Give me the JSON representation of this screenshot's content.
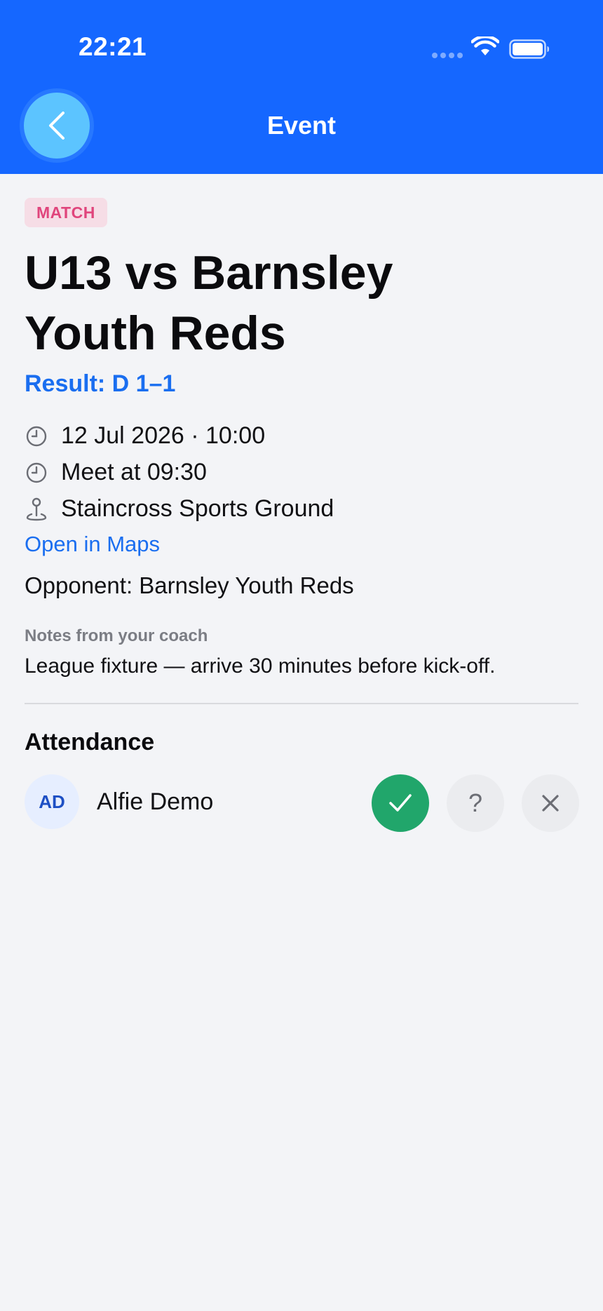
{
  "status_bar": {
    "time": "22:21"
  },
  "header": {
    "title": "Event"
  },
  "event": {
    "type_badge": "MATCH",
    "title": "U13 vs Barnsley Youth Reds",
    "result": "Result: D 1–1",
    "datetime": "12 Jul 2026 · 10:00",
    "meet_time": "Meet at 09:30",
    "location": "Staincross Sports Ground",
    "maps_link": "Open in Maps",
    "opponent": "Opponent: Barnsley Youth Reds",
    "notes_label": "Notes from your coach",
    "notes": "League fixture — arrive 30 minutes before kick-off."
  },
  "attendance": {
    "heading": "Attendance",
    "members": [
      {
        "initials": "AD",
        "name": "Alfie Demo",
        "status": "yes"
      }
    ],
    "maybe_symbol": "?"
  },
  "colors": {
    "header_bg": "#1567ff",
    "accent_link": "#1a6ef0",
    "badge_text": "#e0457c",
    "badge_bg": "#f6dde6",
    "rsvp_yes": "#21a66b"
  }
}
